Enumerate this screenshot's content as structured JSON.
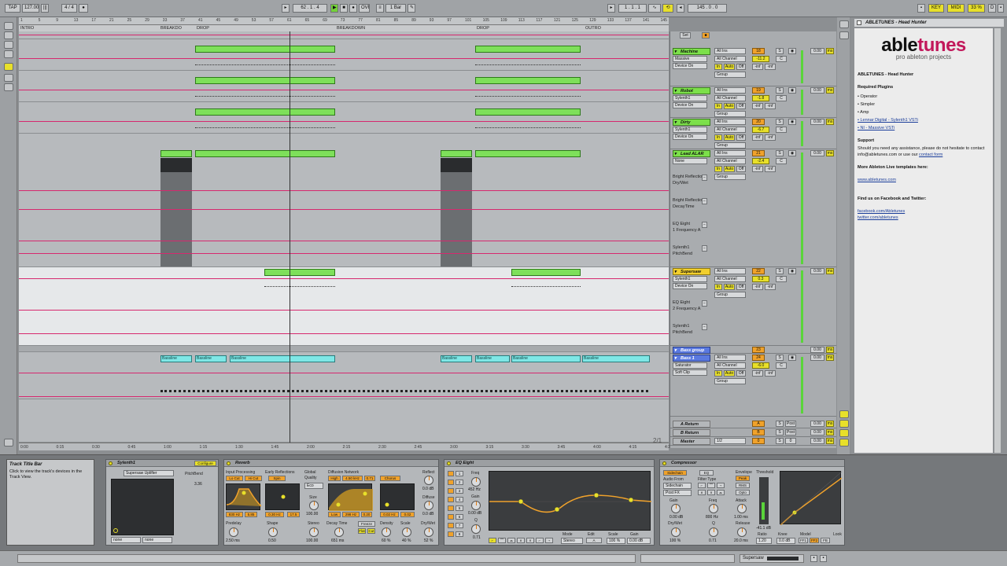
{
  "transport": {
    "tap": "TAP",
    "tempo": "127.00",
    "tempo_ctrl": "|||",
    "meter": "4 / 4",
    "metro": "",
    "quant": "1 Bar",
    "position": "62 . 1 . 4",
    "ovr": "OVR",
    "loop_start": "1 . 1 . 1",
    "loop_len": "145 . 0 . 0",
    "key": "KEY",
    "midi": "MIDI",
    "cpu": "33 %",
    "draw_icon": "pencil-icon"
  },
  "locators": [
    "INTRO",
    "BREAKDO",
    "DROP",
    "BREAKDOWN",
    "DROP",
    "OUTRO"
  ],
  "ruler_marks": [
    "1",
    "5",
    "9",
    "13",
    "17",
    "21",
    "25",
    "29",
    "33",
    "37",
    "41",
    "45",
    "49",
    "53",
    "57",
    "61",
    "65",
    "69",
    "73",
    "77",
    "81",
    "85",
    "89",
    "93",
    "97",
    "101",
    "105",
    "109",
    "113",
    "117",
    "121",
    "125",
    "129",
    "133",
    "137",
    "141",
    "145"
  ],
  "time_marks": [
    "0:00",
    "0:15",
    "0:30",
    "0:45",
    "1:00",
    "1:15",
    "1:30",
    "1:45",
    "2:00",
    "2:15",
    "2:30",
    "2:45",
    "3:00",
    "3:15",
    "3:30",
    "3:45",
    "4:00",
    "4:15",
    "4:30"
  ],
  "page_counter": "2/1",
  "arrange": {
    "clip_label": "Bassline"
  },
  "mixer": {
    "set_label": "Set",
    "tracks": [
      {
        "name": "Machine",
        "color": "green",
        "sel1": "Massive",
        "sel2": "Device On",
        "input": "All Ins",
        "channel": "All Channel",
        "num": "18",
        "vol": "-11.2",
        "pan": "C",
        "group": "Group",
        "send": "0.00",
        "ms": "ms"
      },
      {
        "name": "Robot",
        "color": "green",
        "sel1": "Sylenth1",
        "sel2": "Device On",
        "input": "All Ins",
        "channel": "All Channel",
        "num": "19",
        "vol": "-1.8",
        "pan": "C",
        "group": "Group",
        "send": "0.00",
        "ms": "ms"
      },
      {
        "name": "Dirty",
        "color": "green",
        "sel1": "Sylenth1",
        "sel2": "Device On",
        "input": "All Ins",
        "channel": "All Channel",
        "num": "20",
        "vol": "-6.7",
        "pan": "C",
        "group": "Group",
        "send": "0.00",
        "ms": "ms"
      },
      {
        "name": "Lead ALAR",
        "color": "green",
        "sel1": "None",
        "sel2": "",
        "input": "All Ins",
        "channel": "All Channel",
        "num": "21",
        "vol": "-2.4",
        "pan": "C",
        "group": "Group",
        "send": "0.00",
        "ms": "ms"
      },
      {
        "name": "Supersaw",
        "color": "yellow",
        "sel1": "Sylenth1",
        "sel2": "Device On",
        "input": "All Ins",
        "channel": "All Channel",
        "num": "22",
        "vol": "0.3",
        "pan": "C",
        "group": "Group",
        "send": "0.00",
        "ms": "ms"
      },
      {
        "name": "Bass group",
        "color": "blue",
        "sel1": "",
        "sel2": "",
        "input": "",
        "channel": "",
        "num": "23",
        "vol": "",
        "pan": "",
        "group": "",
        "send": "0.00",
        "ms": "ms"
      },
      {
        "name": "Bass 1",
        "color": "blue",
        "sel1": "Saturator",
        "sel2": "Soft Clip",
        "input": "All Ins",
        "channel": "All Channel",
        "num": "24",
        "vol": "-6.0",
        "pan": "C",
        "group": "Group",
        "send": "0.00",
        "ms": "ms"
      }
    ],
    "lanes": [
      {
        "line1": "Bright Reflectio",
        "line2": "Dry/Wet"
      },
      {
        "line1": "Bright Reflectio",
        "line2": "DecayTime"
      },
      {
        "line1": "EQ Eight",
        "line2": "1 Frequency A"
      },
      {
        "line1": "Sylenth1",
        "line2": "PitchBend"
      },
      {
        "line1": "EQ Eight",
        "line2": "2 Frequency A"
      },
      {
        "line1": "Sylenth1",
        "line2": "PitchBend"
      }
    ],
    "returns": [
      {
        "name": "A Return",
        "letter": "A",
        "post": "Post",
        "send": "0.00",
        "ms": "ms"
      },
      {
        "name": "B Return",
        "letter": "B",
        "post": "Post",
        "send": "0.00",
        "ms": "ms"
      },
      {
        "name": "Master",
        "letter": "0",
        "sel": "1/2",
        "post": "0",
        "send": "0.00",
        "ms": "ms"
      }
    ],
    "in_label": "In",
    "auto_label": "Auto",
    "off_label": "Off",
    "inf_label": "-inf",
    "s_label": "S"
  },
  "help": {
    "title": "ABLETUNES - Head Hunter",
    "logo_main": "able",
    "logo_accent": "tunes",
    "logo_sub": "pro ableton projects",
    "heading": "ABLETUNES - Head Hunter",
    "required": "Required Plugins",
    "plugins": [
      "Operator",
      "Simpler",
      "Amp",
      "Lennar Digital - Sylenth1 VSTi",
      "NI - Massive VSTi"
    ],
    "support_h": "Support",
    "support_p1": "Should you need any assistance, please do not hesitate to contact info@abletunes.com or use our",
    "support_link": "contact form",
    "more_h": "More Ableton Live templates here:",
    "more_link": "www.abletunes.com",
    "find_h": "Find us on Facebook and Twitter:",
    "fb": "facebook.com/Abletunes",
    "tw": "twitter.com/abletunes"
  },
  "devices": {
    "info": {
      "title": "Track Title Bar",
      "body": "Click to view the track's devices in the Track View."
    },
    "sylenth": {
      "title": "Sylenth1",
      "configure": "Configure",
      "preset": "Supersaw Uplifter",
      "param": "PitchBend",
      "param_val": "3.36",
      "none1": "none",
      "none2": "none"
    },
    "reverb": {
      "title": "Reverb",
      "input_processing": "Input Processing",
      "lo_cut": "Lo Cut",
      "hi_cut": "Hi Cut",
      "early_ref": "Early Reflections",
      "spin": "Spin",
      "global": "Global",
      "quality": "Quality",
      "quality_val": "Eco",
      "diffusion": "Diffusion Network",
      "high": "High",
      "high_val": "4.50 kHz",
      "high_q": "0.71",
      "chorus": "Chorus",
      "reflect": "Reflect",
      "reflect_val": "0.0 dB",
      "diffuse": "Diffuse",
      "diffuse_val": "0.0 dB",
      "v1": "830 Hz",
      "v2": "5.85",
      "v3": "0.30 Hz",
      "v4": "17.5",
      "size_l": "Size",
      "size_v": "100.00",
      "low": "Low",
      "low_val": "298 Hz",
      "low_q": "0.20",
      "v5": "0.02 Hz",
      "v6": "0.02",
      "predelay_l": "Predelay",
      "predelay_v": "2.50 ms",
      "shape_l": "Shape",
      "shape_v": "0.50",
      "stereo_l": "Stereo",
      "stereo_v": "100.00",
      "decay_l": "Decay Time",
      "decay_v": "651 ms",
      "freeze": "Freeze",
      "flat": "Flat",
      "cut": "Cut",
      "density_l": "Density",
      "density_v": "60 %",
      "scale_l": "Scale",
      "scale_v": "40 %",
      "drywet_l": "Dry/Wet",
      "drywet_v": "52 %"
    },
    "eq": {
      "title": "EQ Eight",
      "freq_l": "Freq",
      "freq_v": "452 Hz",
      "gain_l": "Gain",
      "gain_v": "0.00 dB",
      "q_l": "Q",
      "q_v": "0.71",
      "mode_l": "Mode",
      "mode_v": "Stereo",
      "edit_l": "Edit",
      "edit_v": "A",
      "scale_l": "Scale",
      "scale_v": "100 %",
      "gain2_l": "Gain",
      "gain2_v": "0.00 dB",
      "bands": [
        "1",
        "2",
        "3",
        "4",
        "5",
        "6",
        "7",
        "8"
      ]
    },
    "comp": {
      "title": "Compressor",
      "sidechain": "Sidechain",
      "eq": "EQ",
      "audio_from": "Audio From",
      "af_v": "Sidechain",
      "post": "Post FX",
      "filter_type": "Filter Type",
      "env": "Envelope",
      "peak": "Peak",
      "rms": "RMS",
      "opto": "Opto",
      "threshold": "Threshold",
      "gain_l": "Gain",
      "gain_v": "0.00 dB",
      "freq_l": "Freq",
      "freq_v": "800 Hz",
      "attack_l": "Attack",
      "attack_v": "1.00 ms",
      "drywet_l": "Dry/Wet",
      "drywet_v": "100 %",
      "q_l": "Q",
      "q_v": "0.71",
      "release_l": "Release",
      "release_v": "20.0 ms",
      "thr_v": "-41.1 dB",
      "ratio_l": "Ratio",
      "ratio_v": "1.20",
      "knee_l": "Knee",
      "knee_v": "0.0 dB",
      "model_l": "Model",
      "ff1": "FF1",
      "ff2": "FF2",
      "fb": "FB",
      "look_l": "Look"
    }
  },
  "status": {
    "track": "Supersaw"
  }
}
